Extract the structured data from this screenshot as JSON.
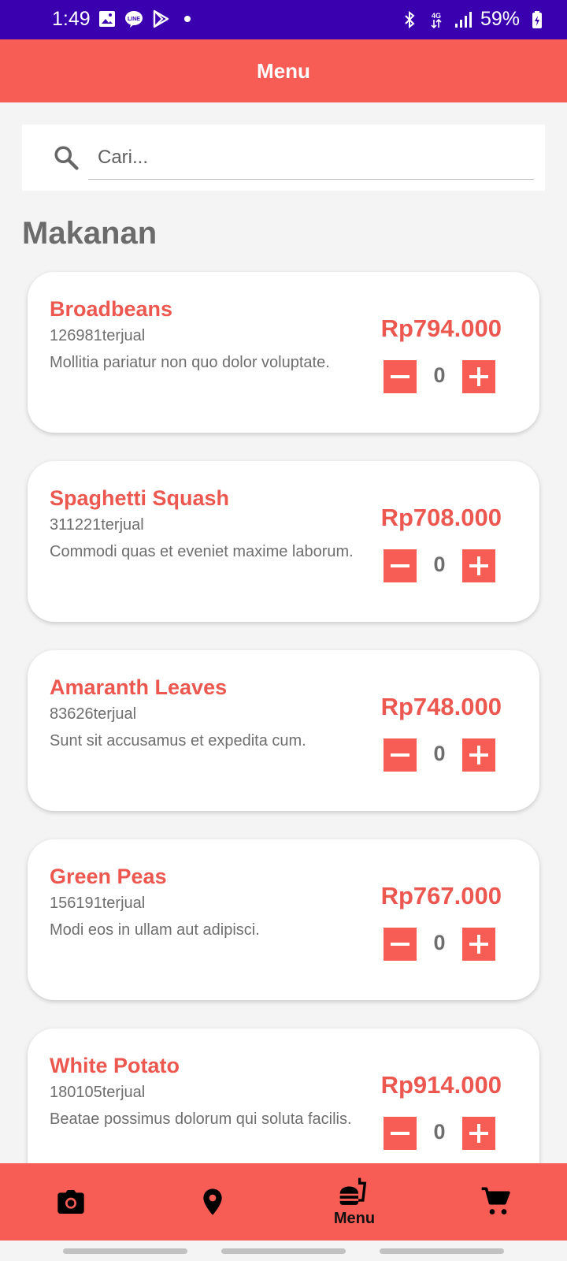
{
  "status_bar": {
    "time": "1:49",
    "battery": "59%",
    "network": "4G",
    "color": "#3a00b0"
  },
  "app_bar": {
    "title": "Menu",
    "color": "#f75c55"
  },
  "search": {
    "placeholder": "Cari..."
  },
  "section_title": "Makanan",
  "items": [
    {
      "name": "Broadbeans",
      "sold": "126981terjual",
      "desc": "Mollitia pariatur non quo dolor voluptate.",
      "price": "Rp794.000",
      "qty": "0"
    },
    {
      "name": "Spaghetti Squash",
      "sold": "311221terjual",
      "desc": "Commodi quas et eveniet maxime laborum.",
      "price": "Rp708.000",
      "qty": "0"
    },
    {
      "name": "Amaranth Leaves",
      "sold": "83626terjual",
      "desc": "Sunt sit accusamus et expedita cum.",
      "price": "Rp748.000",
      "qty": "0"
    },
    {
      "name": "Green Peas",
      "sold": "156191terjual",
      "desc": "Modi eos in ullam aut adipisci.",
      "price": "Rp767.000",
      "qty": "0"
    },
    {
      "name": "White Potato",
      "sold": "180105terjual",
      "desc": "Beatae possimus dolorum qui soluta facilis.",
      "price": "Rp914.000",
      "qty": "0"
    }
  ],
  "bottom_nav": {
    "items": [
      {
        "icon": "camera-icon"
      },
      {
        "icon": "location-pin-icon"
      },
      {
        "icon": "fastfood-icon",
        "label": "Menu",
        "active": true
      },
      {
        "icon": "cart-icon"
      }
    ]
  },
  "colors": {
    "accent": "#f75c55",
    "text_accent": "#ec5750",
    "muted": "#6e6e6e",
    "background": "#f4f4f4"
  }
}
